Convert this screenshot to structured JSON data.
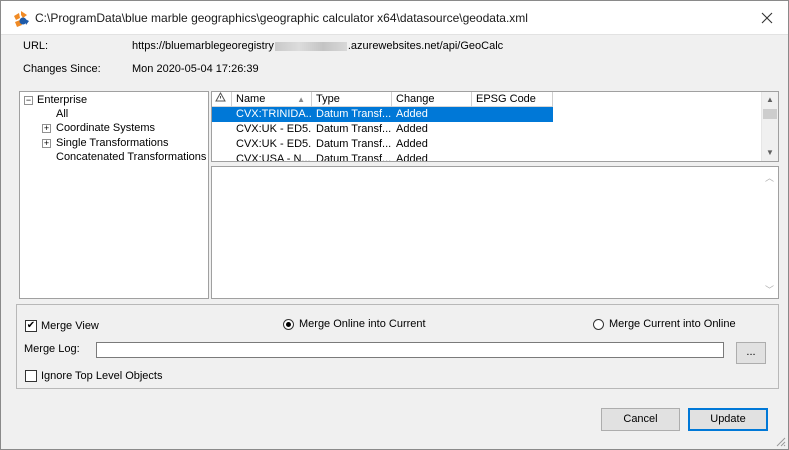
{
  "window": {
    "title": "C:\\ProgramData\\blue marble geographics\\geographic calculator x64\\datasource\\geodata.xml"
  },
  "info": {
    "url_label": "URL:",
    "url_prefix": "https://bluemarblegeoregistry",
    "url_suffix": ".azurewebsites.net/api/GeoCalc",
    "changes_label": "Changes Since:",
    "changes_value": "Mon 2020-05-04 17:26:39"
  },
  "tree": {
    "root": "Enterprise",
    "items": [
      "All",
      "Coordinate Systems",
      "Single Transformations",
      "Concatenated Transformations"
    ]
  },
  "grid": {
    "columns": [
      "Name",
      "Type",
      "Change",
      "EPSG Code"
    ],
    "rows": [
      {
        "name": "CVX:TRINIDA...",
        "type": "Datum Transf...",
        "change": "Added",
        "epsg": ""
      },
      {
        "name": "CVX:UK - ED5...",
        "type": "Datum Transf...",
        "change": "Added",
        "epsg": ""
      },
      {
        "name": "CVX:UK - ED5...",
        "type": "Datum Transf...",
        "change": "Added",
        "epsg": ""
      },
      {
        "name": "CVX:USA - N...",
        "type": "Datum Transf...",
        "change": "Added",
        "epsg": ""
      }
    ]
  },
  "options": {
    "merge_view": "Merge View",
    "merge_online": "Merge Online into Current",
    "merge_current": "Merge Current into Online",
    "merge_log_label": "Merge Log:",
    "merge_log_value": "",
    "browse_label": "...",
    "ignore_top": "Ignore Top Level Objects"
  },
  "buttons": {
    "cancel": "Cancel",
    "update": "Update"
  },
  "colors": {
    "selection": "#0078d7",
    "app_icon_orange": "#f08a24",
    "app_icon_blue": "#1e5aa8"
  }
}
